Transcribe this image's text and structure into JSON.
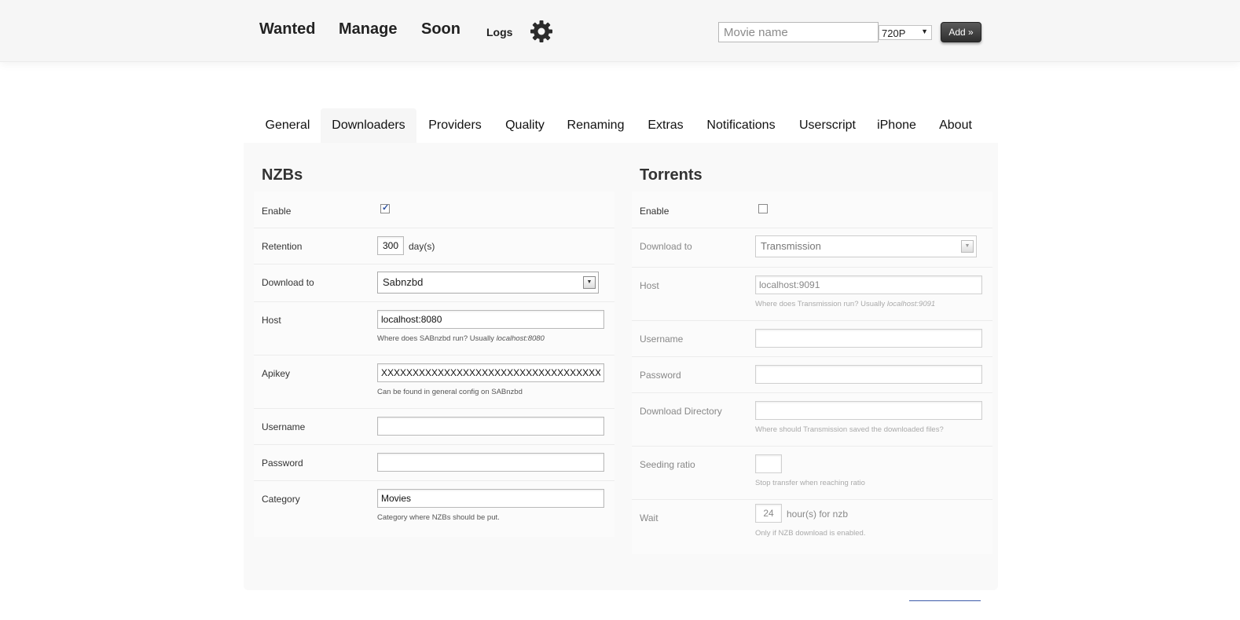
{
  "header": {
    "nav": [
      "Wanted",
      "Manage",
      "Soon"
    ],
    "logs": "Logs",
    "settings_icon": "gear-icon",
    "movie_placeholder": "Movie name",
    "quality_selected": "720P",
    "add_label": "Add »"
  },
  "tabs": [
    "General",
    "Downloaders",
    "Providers",
    "Quality",
    "Renaming",
    "Extras",
    "Notifications",
    "Userscript",
    "iPhone",
    "About"
  ],
  "active_tab": "Downloaders",
  "nzbs": {
    "title": "NZBs",
    "enable_label": "Enable",
    "enabled": true,
    "retention_label": "Retention",
    "retention_value": "300",
    "retention_unit": "day(s)",
    "download_to_label": "Download to",
    "download_to_value": "Sabnzbd",
    "host_label": "Host",
    "host_value": "localhost:8080",
    "host_hint": "Where does SABnzbd run? Usually ",
    "host_hint_em": "localhost:8080",
    "apikey_label": "Apikey",
    "apikey_value": "XXXXXXXXXXXXXXXXXXXXXXXXXXXXXXXXXXX",
    "apikey_hint": "Can be found in general config on SABnzbd",
    "username_label": "Username",
    "username_value": "",
    "password_label": "Password",
    "password_value": "",
    "category_label": "Category",
    "category_value": "Movies",
    "category_hint": "Category where NZBs should be put."
  },
  "torrents": {
    "title": "Torrents",
    "enable_label": "Enable",
    "enabled": false,
    "download_to_label": "Download to",
    "download_to_value": "Transmission",
    "host_label": "Host",
    "host_value": "localhost:9091",
    "host_hint": "Where does Transmission run? Usually ",
    "host_hint_em": "localhost:9091",
    "username_label": "Username",
    "username_value": "",
    "password_label": "Password",
    "password_value": "",
    "directory_label": "Download Directory",
    "directory_value": "",
    "directory_hint": "Where should Transmission saved the downloaded files?",
    "seeding_label": "Seeding ratio",
    "seeding_value": "",
    "seeding_hint": "Stop transfer when reaching ratio",
    "wait_label": "Wait",
    "wait_value": "24",
    "wait_unit": "hour(s) for nzb",
    "wait_hint": "Only if NZB download is enabled."
  }
}
